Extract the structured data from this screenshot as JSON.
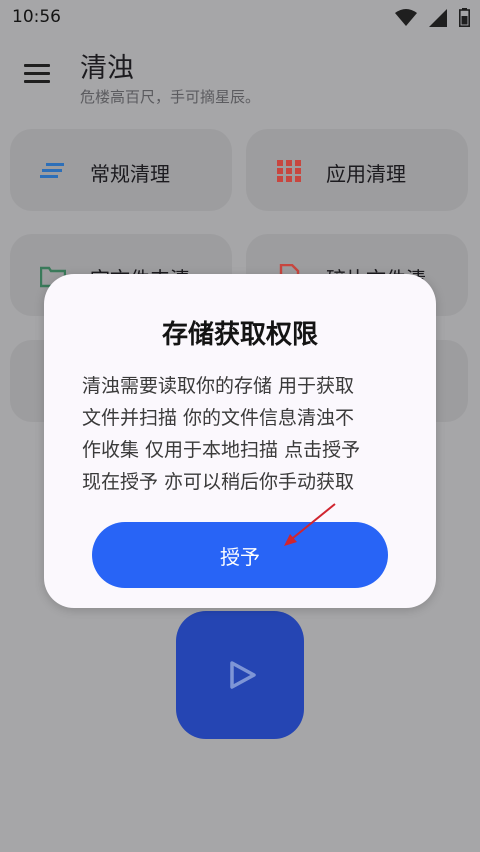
{
  "status_bar": {
    "time": "10:56",
    "icons": [
      "wifi-icon",
      "signal-icon",
      "battery-icon"
    ]
  },
  "app_bar": {
    "title": "清浊",
    "subtitle": "危楼高百尺，手可摘星辰。",
    "menu_icon": "hamburger-menu-icon"
  },
  "cards": [
    {
      "label": "常规清理",
      "icon": "lines-icon",
      "color": "#2d6fb8"
    },
    {
      "label": "应用清理",
      "icon": "grid-icon",
      "color": "#c8463f"
    },
    {
      "label": "空文件夹清",
      "icon": "folder-icon",
      "color": "#3a7a5a"
    },
    {
      "label": "碎片文件清",
      "icon": "document-icon",
      "color": "#c8463f"
    }
  ],
  "play_button": {
    "icon": "play-icon"
  },
  "dialog": {
    "title": "存储获取权限",
    "body_lines": [
      "清浊需要读取你的存储 用于获取",
      "文件并扫描 你的文件信息清浊不",
      "作收集 仅用于本地扫描 点击授予",
      "现在授予 亦可以稍后你手动获取"
    ],
    "grant_button_label": "授予"
  },
  "colors": {
    "scrim_background": "#a6a6a8",
    "card_background": "#9d9d9f",
    "dialog_background": "#fbf8fd",
    "grant_button": "#2864f6",
    "play_button": "#2545b3",
    "annotation_arrow": "#d0252f"
  }
}
